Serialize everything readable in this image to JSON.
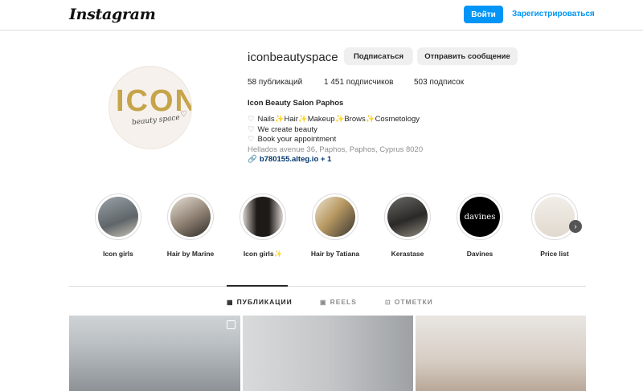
{
  "header": {
    "logo": "Instagram",
    "login_label": "Войти",
    "signup_label": "Зарегистрироваться"
  },
  "profile": {
    "username": "iconbeautyspace",
    "follow_label": "Подписаться",
    "message_label": "Отправить сообщение",
    "stats": {
      "posts": "58 публикаций",
      "followers": "1 451 подписчиков",
      "following": "503 подписок"
    },
    "avatar": {
      "logo_word": "ICON",
      "logo_script": "beauty space"
    },
    "bio": {
      "name": "Icon Beauty Salon Paphos",
      "lines": [
        "Nails✨Hair✨Makeup✨Brows✨Cosmetology",
        "We create beauty",
        "Book your appointment"
      ],
      "address": "Hellados avenue 36, Paphos, Paphos, Cyprus 8020",
      "link": "b780155.alteg.io + 1"
    }
  },
  "highlights": [
    {
      "label": "Icon girls"
    },
    {
      "label": "Hair by Marine"
    },
    {
      "label": "Icon girls✨"
    },
    {
      "label": "Hair by Tatiana"
    },
    {
      "label": "Kerastase"
    },
    {
      "label": "Davines",
      "text": "davines"
    },
    {
      "label": "Price list"
    }
  ],
  "tabs": {
    "posts": "ПУБЛИКАЦИИ",
    "reels": "REELS",
    "tagged": "ОТМЕТКИ"
  },
  "icons": {
    "tab_posts": "grid-icon",
    "tab_reels": "reels-icon",
    "tab_tagged": "tagged-icon",
    "bio_line": "heart-icon",
    "link": "chain-link-icon"
  },
  "colors": {
    "accent": "#0095f6",
    "link": "#00376b",
    "logo_gold": "#c6a44a"
  }
}
